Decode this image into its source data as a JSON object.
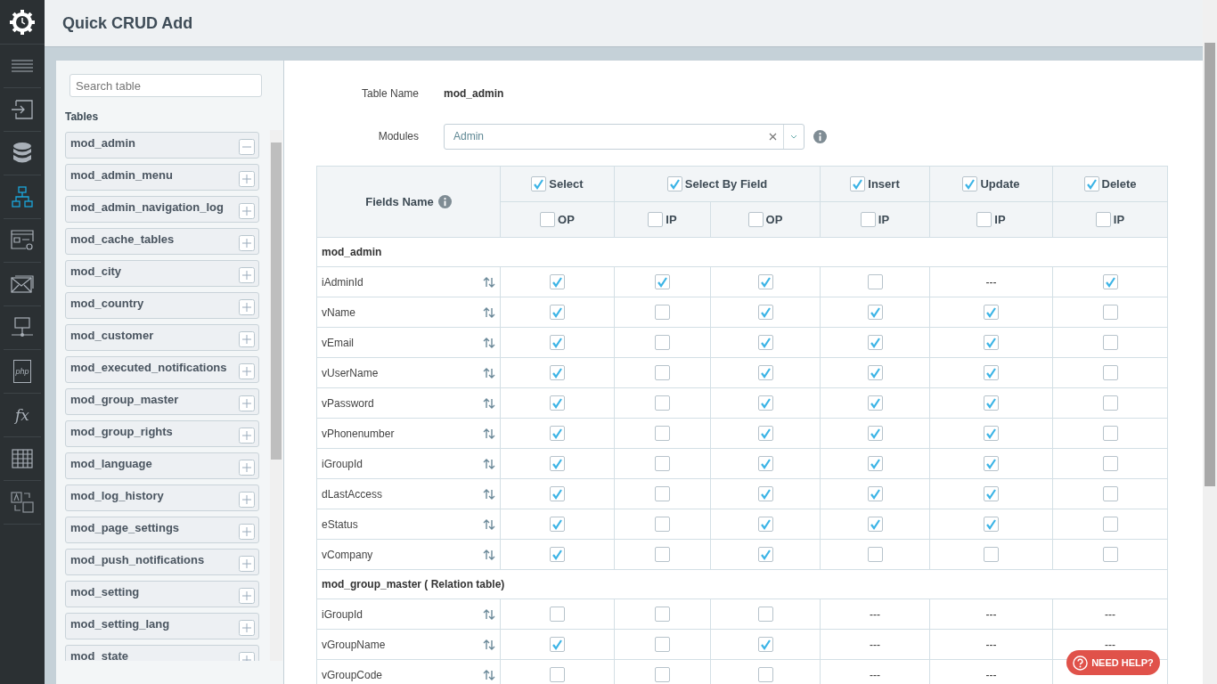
{
  "sidebar": {
    "items": [
      {
        "kind": "logo",
        "selected": false
      },
      {
        "kind": "menu",
        "selected": false
      },
      {
        "kind": "signin",
        "selected": false
      },
      {
        "kind": "database",
        "selected": false
      },
      {
        "kind": "sitemap",
        "selected": true
      },
      {
        "kind": "window-gear",
        "selected": false
      },
      {
        "kind": "mail",
        "selected": false
      },
      {
        "kind": "network",
        "selected": false
      },
      {
        "kind": "php",
        "selected": false,
        "text": "php"
      },
      {
        "kind": "fx",
        "selected": false,
        "text": "fx"
      },
      {
        "kind": "table",
        "selected": false
      },
      {
        "kind": "translate",
        "selected": false
      }
    ]
  },
  "header": {
    "title": "Quick CRUD Add"
  },
  "tables_panel": {
    "search": {
      "placeholder": "Search table"
    },
    "heading": "Tables",
    "items": [
      {
        "name": "mod_admin",
        "expanded": true
      },
      {
        "name": "mod_admin_menu",
        "expanded": false
      },
      {
        "name": "mod_admin_navigation_log",
        "expanded": false
      },
      {
        "name": "mod_cache_tables",
        "expanded": false
      },
      {
        "name": "mod_city",
        "expanded": false
      },
      {
        "name": "mod_country",
        "expanded": false
      },
      {
        "name": "mod_customer",
        "expanded": false
      },
      {
        "name": "mod_executed_notifications",
        "expanded": false
      },
      {
        "name": "mod_group_master",
        "expanded": false
      },
      {
        "name": "mod_group_rights",
        "expanded": false
      },
      {
        "name": "mod_language",
        "expanded": false
      },
      {
        "name": "mod_log_history",
        "expanded": false
      },
      {
        "name": "mod_page_settings",
        "expanded": false
      },
      {
        "name": "mod_push_notifications",
        "expanded": false
      },
      {
        "name": "mod_setting",
        "expanded": false
      },
      {
        "name": "mod_setting_lang",
        "expanded": false
      },
      {
        "name": "mod_state",
        "expanded": false
      }
    ]
  },
  "form": {
    "table_name_label": "Table Name",
    "table_name": "mod_admin",
    "modules_label": "Modules",
    "modules_value": "Admin"
  },
  "grid": {
    "fields_heading": "Fields Name",
    "columns": [
      {
        "label": "Select",
        "checked": true,
        "subs": [
          {
            "label": "OP",
            "checked": false
          }
        ]
      },
      {
        "label": "Select By Field",
        "checked": true,
        "subs": [
          {
            "label": "IP",
            "checked": false
          },
          {
            "label": "OP",
            "checked": false
          }
        ]
      },
      {
        "label": "Insert",
        "checked": true,
        "subs": [
          {
            "label": "IP",
            "checked": false
          }
        ]
      },
      {
        "label": "Update",
        "checked": true,
        "subs": [
          {
            "label": "IP",
            "checked": false
          }
        ]
      },
      {
        "label": "Delete",
        "checked": true,
        "subs": [
          {
            "label": "IP",
            "checked": false
          }
        ]
      }
    ],
    "groups": [
      {
        "title": "mod_admin",
        "rows": [
          {
            "name": "iAdminId",
            "cells": [
              {
                "kind": "check",
                "checked": true
              },
              {
                "kind": "check",
                "checked": true
              },
              {
                "kind": "check",
                "checked": true
              },
              {
                "kind": "check",
                "checked": false
              },
              {
                "kind": "dash",
                "text": "---"
              },
              {
                "kind": "check",
                "checked": true
              }
            ]
          },
          {
            "name": "vName",
            "cells": [
              {
                "kind": "check",
                "checked": true
              },
              {
                "kind": "check",
                "checked": false
              },
              {
                "kind": "check",
                "checked": true
              },
              {
                "kind": "check",
                "checked": true
              },
              {
                "kind": "check",
                "checked": true
              },
              {
                "kind": "check",
                "checked": false
              }
            ]
          },
          {
            "name": "vEmail",
            "cells": [
              {
                "kind": "check",
                "checked": true
              },
              {
                "kind": "check",
                "checked": false
              },
              {
                "kind": "check",
                "checked": true
              },
              {
                "kind": "check",
                "checked": true
              },
              {
                "kind": "check",
                "checked": true
              },
              {
                "kind": "check",
                "checked": false
              }
            ]
          },
          {
            "name": "vUserName",
            "cells": [
              {
                "kind": "check",
                "checked": true
              },
              {
                "kind": "check",
                "checked": false
              },
              {
                "kind": "check",
                "checked": true
              },
              {
                "kind": "check",
                "checked": true
              },
              {
                "kind": "check",
                "checked": true
              },
              {
                "kind": "check",
                "checked": false
              }
            ]
          },
          {
            "name": "vPassword",
            "cells": [
              {
                "kind": "check",
                "checked": true
              },
              {
                "kind": "check",
                "checked": false
              },
              {
                "kind": "check",
                "checked": true
              },
              {
                "kind": "check",
                "checked": true
              },
              {
                "kind": "check",
                "checked": true
              },
              {
                "kind": "check",
                "checked": false
              }
            ]
          },
          {
            "name": "vPhonenumber",
            "cells": [
              {
                "kind": "check",
                "checked": true
              },
              {
                "kind": "check",
                "checked": false
              },
              {
                "kind": "check",
                "checked": true
              },
              {
                "kind": "check",
                "checked": true
              },
              {
                "kind": "check",
                "checked": true
              },
              {
                "kind": "check",
                "checked": false
              }
            ]
          },
          {
            "name": "iGroupId",
            "cells": [
              {
                "kind": "check",
                "checked": true
              },
              {
                "kind": "check",
                "checked": false
              },
              {
                "kind": "check",
                "checked": true
              },
              {
                "kind": "check",
                "checked": true
              },
              {
                "kind": "check",
                "checked": true
              },
              {
                "kind": "check",
                "checked": false
              }
            ]
          },
          {
            "name": "dLastAccess",
            "cells": [
              {
                "kind": "check",
                "checked": true
              },
              {
                "kind": "check",
                "checked": false
              },
              {
                "kind": "check",
                "checked": true
              },
              {
                "kind": "check",
                "checked": true
              },
              {
                "kind": "check",
                "checked": true
              },
              {
                "kind": "check",
                "checked": false
              }
            ]
          },
          {
            "name": "eStatus",
            "cells": [
              {
                "kind": "check",
                "checked": true
              },
              {
                "kind": "check",
                "checked": false
              },
              {
                "kind": "check",
                "checked": true
              },
              {
                "kind": "check",
                "checked": true
              },
              {
                "kind": "check",
                "checked": true
              },
              {
                "kind": "check",
                "checked": false
              }
            ]
          },
          {
            "name": "vCompany",
            "cells": [
              {
                "kind": "check",
                "checked": true
              },
              {
                "kind": "check",
                "checked": false
              },
              {
                "kind": "check",
                "checked": true
              },
              {
                "kind": "check",
                "checked": false
              },
              {
                "kind": "check",
                "checked": false
              },
              {
                "kind": "check",
                "checked": false
              }
            ]
          }
        ]
      },
      {
        "title": "mod_group_master ( Relation table)",
        "rows": [
          {
            "name": "iGroupId",
            "cells": [
              {
                "kind": "check",
                "checked": false
              },
              {
                "kind": "check",
                "checked": false
              },
              {
                "kind": "check",
                "checked": false
              },
              {
                "kind": "dash",
                "text": "---"
              },
              {
                "kind": "dash",
                "text": "---"
              },
              {
                "kind": "dash",
                "text": "---"
              }
            ]
          },
          {
            "name": "vGroupName",
            "cells": [
              {
                "kind": "check",
                "checked": true
              },
              {
                "kind": "check",
                "checked": false
              },
              {
                "kind": "check",
                "checked": true
              },
              {
                "kind": "dash",
                "text": "---"
              },
              {
                "kind": "dash",
                "text": "---"
              },
              {
                "kind": "dash",
                "text": "---"
              }
            ]
          },
          {
            "name": "vGroupCode",
            "cells": [
              {
                "kind": "check",
                "checked": false
              },
              {
                "kind": "check",
                "checked": false
              },
              {
                "kind": "check",
                "checked": false
              },
              {
                "kind": "dash",
                "text": "---"
              },
              {
                "kind": "dash",
                "text": "---"
              }
            ]
          }
        ]
      }
    ]
  },
  "help_button": {
    "label": "NEED HELP?"
  }
}
